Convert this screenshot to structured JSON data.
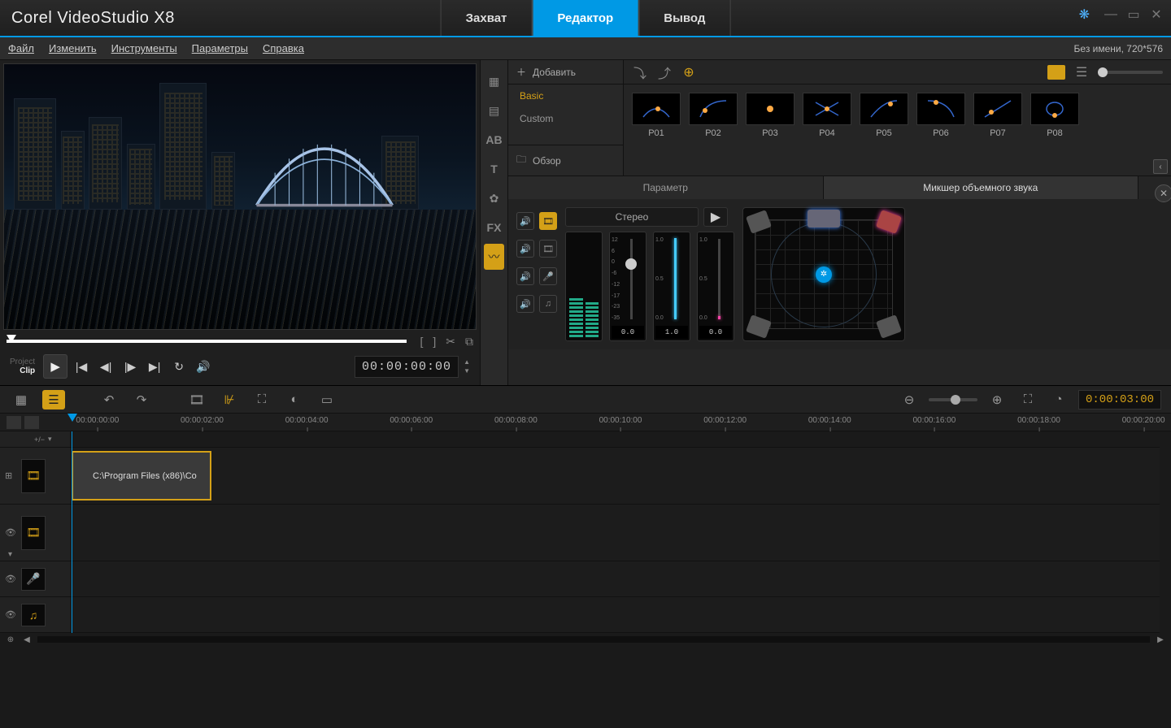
{
  "app_title": "Corel VideoStudio X8",
  "modes": {
    "capture": "Захват",
    "edit": "Редактор",
    "output": "Вывод"
  },
  "menu": {
    "file": "Файл",
    "edit": "Изменить",
    "tools": "Инструменты",
    "options": "Параметры",
    "help": "Справка"
  },
  "project_info": "Без имени, 720*576",
  "preview": {
    "mode_project": "Project",
    "mode_clip": "Clip",
    "timecode": "00:00:00:00"
  },
  "library": {
    "add": "Добавить",
    "categories": {
      "basic": "Basic",
      "custom": "Custom"
    },
    "review": "Обзор",
    "presets": [
      "P01",
      "P02",
      "P03",
      "P04",
      "P05",
      "P06",
      "P07",
      "P08"
    ]
  },
  "mixer": {
    "tab_param": "Параметр",
    "tab_surround": "Микшер объемного звука",
    "stereo": "Стерео",
    "fader_scale": [
      "12",
      "6",
      "0",
      "-6",
      "-12",
      "-17",
      "-23",
      "-35"
    ],
    "fader1": {
      "scale_top": "1.0",
      "scale_mid": "0.5",
      "scale_bot": "0.0",
      "value": "1.0"
    },
    "fader2": {
      "scale_top": "1.0",
      "scale_mid": "0.5",
      "scale_bot": "0.0",
      "value": "0.0"
    }
  },
  "timeline": {
    "duration": "0:00:03:00",
    "ruler": [
      "00:00:00:00",
      "00:00:02:00",
      "00:00:04:00",
      "00:00:06:00",
      "00:00:08:00",
      "00:00:10:00",
      "00:00:12:00",
      "00:00:14:00",
      "00:00:16:00",
      "00:00:18:00",
      "00:00:20:00"
    ],
    "toggle": "+/−",
    "clip_path": "C:\\Program Files (x86)\\Co"
  }
}
